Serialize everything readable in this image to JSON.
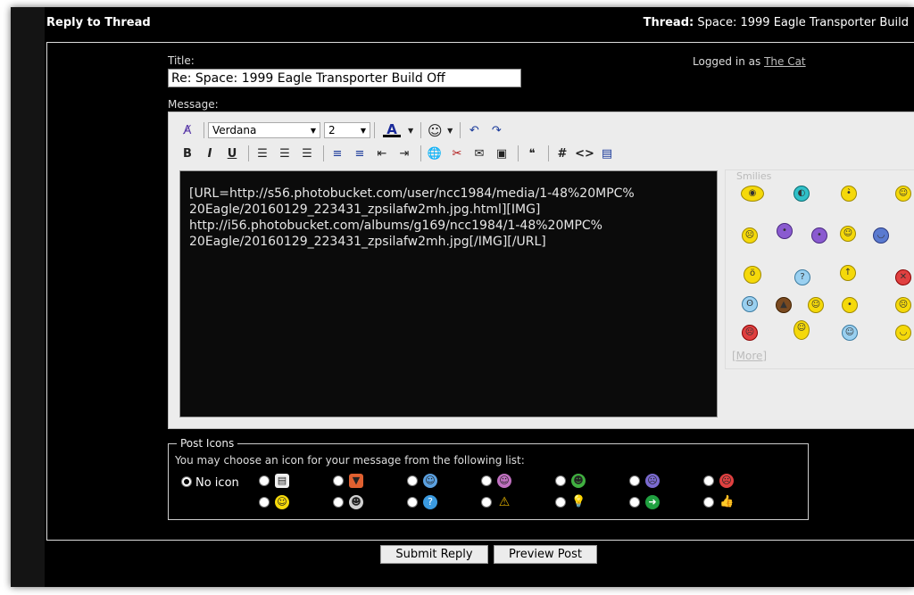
{
  "header": {
    "left_title": "Reply to Thread",
    "thread_label": "Thread:",
    "thread_name": "Space: 1999 Eagle Transporter Build"
  },
  "form": {
    "title_label": "Title:",
    "title_value": "Re: Space: 1999 Eagle Transporter Build Off",
    "message_label": "Message:",
    "logged_in_prefix": "Logged in as",
    "username": "The Cat"
  },
  "toolbar": {
    "font_name": "Verdana",
    "font_size": "2",
    "font_color_glyph": "A",
    "bold": "B",
    "italic": "I",
    "underline": "U",
    "hash": "#",
    "code": "<>"
  },
  "message": {
    "lines": [
      "[URL=http://s56.photobucket.com/user/ncc1984/media/1-48%20MPC%",
      "20Eagle/20160129_223431_zpsilafw2mh.jpg.html][IMG]",
      "http://i56.photobucket.com/albums/g169/ncc1984/1-48%20MPC%",
      "20Eagle/20160129_223431_zpsilafw2mh.jpg[/IMG][/URL]"
    ]
  },
  "smilies": {
    "legend": "Smilies",
    "more": "[More]"
  },
  "post_icons": {
    "legend": "Post Icons",
    "description": "You may choose an icon for your message from the following list:",
    "no_icon_label": "No icon"
  },
  "buttons": {
    "submit": "Submit Reply",
    "preview": "Preview Post"
  },
  "colors": {
    "background": "#000000",
    "editor_bg": "#ececec",
    "text_area_bg": "#0b0b0b"
  }
}
